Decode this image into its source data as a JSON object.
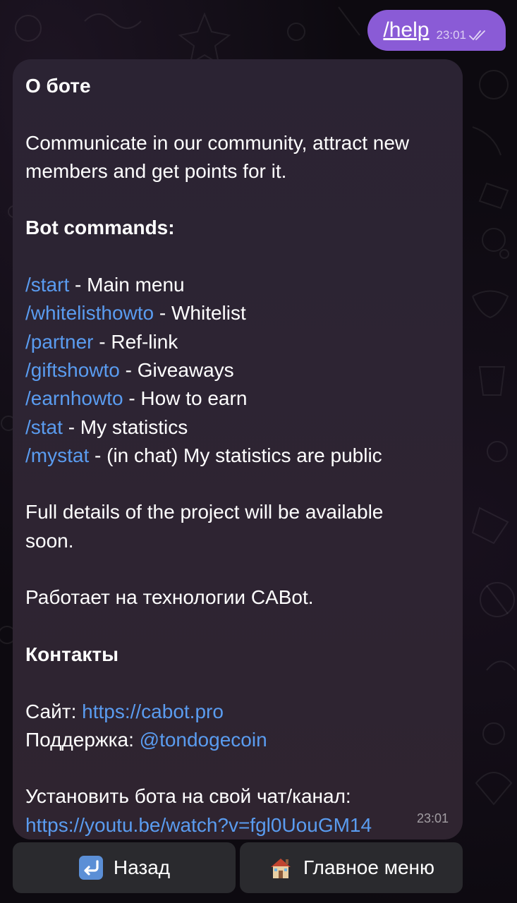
{
  "outgoing": {
    "text": "/help",
    "time": "23:01"
  },
  "message": {
    "title": "О боте",
    "intro_1": "Communicate in our community, attract new",
    "intro_2": "members and get points for it.",
    "commands_heading": "Bot commands:",
    "commands": [
      {
        "cmd": "/start",
        "desc": " - Main menu"
      },
      {
        "cmd": "/whitelisthowto",
        "desc": " - Whitelist"
      },
      {
        "cmd": "/partner",
        "desc": " - Ref-link"
      },
      {
        "cmd": "/giftshowto",
        "desc": " - Giveaways"
      },
      {
        "cmd": "/earnhowto",
        "desc": " - How to earn"
      },
      {
        "cmd": "/stat",
        "desc": " - My statistics"
      },
      {
        "cmd": "/mystat",
        "desc": " - (in chat) My statistics are public"
      }
    ],
    "details_1": "Full details of the project will be available",
    "details_2": "soon.",
    "powered": "Работает на технологии CABot.",
    "contacts_heading": "Контакты",
    "site_label": "Сайт: ",
    "site_link": "https://cabot.pro",
    "support_label": "Поддержка: ",
    "support_link": "@tondogecoin",
    "install_label": "Установить бота на свой чат/канал:",
    "install_link": "https://youtu.be/watch?v=fgl0UouGM14",
    "time": "23:01"
  },
  "keyboard": {
    "back_label": "Назад",
    "back_icon": "return-arrow-icon",
    "main_label": "Главное меню",
    "main_icon": "house-icon"
  },
  "colors": {
    "outgoing_bubble": "#8a5bd6",
    "link": "#5a9cf0",
    "incoming_bubble": "#2d2433",
    "button": "#2a2a2e"
  }
}
